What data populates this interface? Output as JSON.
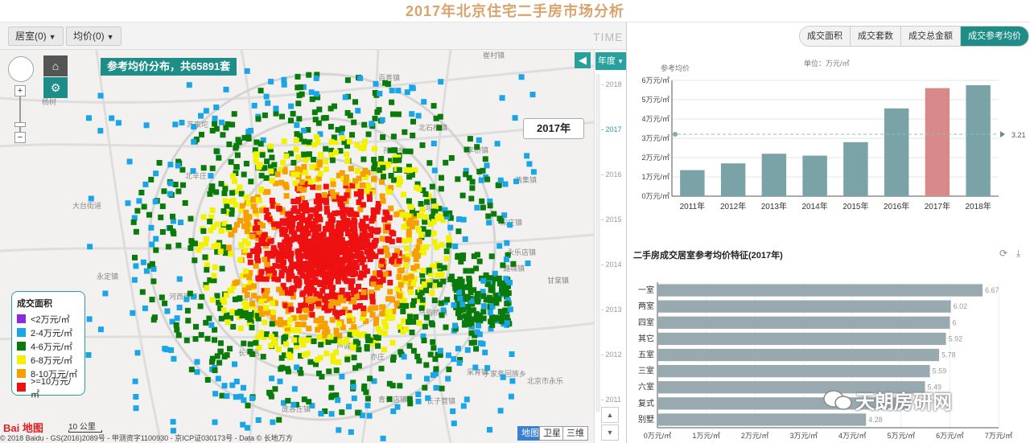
{
  "title": "2017年北京住宅二手房市场分析",
  "toolbar": {
    "room_dd": "居室(0)",
    "price_dd": "均价(0)",
    "time_label": "TIME"
  },
  "map": {
    "count_banner": "参考均价分布，共65891套",
    "year_bubble": "2017年",
    "legend": {
      "title": "成交面积",
      "items": [
        {
          "label": "<2万元/㎡",
          "color": "#8a2be2"
        },
        {
          "label": "2-4万元/㎡",
          "color": "#1aa6e6"
        },
        {
          "label": "4-6万元/㎡",
          "color": "#0a7a0a"
        },
        {
          "label": "6-8万元/㎡",
          "color": "#f2f200"
        },
        {
          "label": "8-10万元/㎡",
          "color": "#f5a000"
        },
        {
          "label": ">=10万元/㎡",
          "color": "#ee1111"
        }
      ]
    },
    "scale": "10 公里",
    "baidu_logo": "Bai 地图",
    "copyright": "© 2018 Baidu - GS(2016)2089号 - 甲测资字1100930 - 京ICP证030173号 - Data © 长地万方",
    "map_types": [
      "地图",
      "卫星",
      "三维"
    ],
    "place_labels": [
      {
        "t": "苏家坨",
        "x": 232,
        "y": 96
      },
      {
        "t": "杨树",
        "x": 52,
        "y": 68
      },
      {
        "t": "大台街道",
        "x": 90,
        "y": 197
      },
      {
        "t": "北辛庄",
        "x": 230,
        "y": 160
      },
      {
        "t": "永定镇",
        "x": 120,
        "y": 285
      },
      {
        "t": "河西街道",
        "x": 210,
        "y": 310
      },
      {
        "t": "长辛店",
        "x": 296,
        "y": 380
      },
      {
        "t": "卢沟桥",
        "x": 300,
        "y": 315
      },
      {
        "t": "东坝乡",
        "x": 520,
        "y": 200
      },
      {
        "t": "黑庄户乡",
        "x": 532,
        "y": 292
      },
      {
        "t": "台湖镇",
        "x": 572,
        "y": 312
      },
      {
        "t": "宋庄镇",
        "x": 622,
        "y": 218
      },
      {
        "t": "永乐店镇",
        "x": 630,
        "y": 255
      },
      {
        "t": "甘棠镇",
        "x": 680,
        "y": 290
      },
      {
        "t": "亦庄",
        "x": 460,
        "y": 385
      },
      {
        "t": "采育镇",
        "x": 580,
        "y": 404
      },
      {
        "t": "庞各庄镇",
        "x": 350,
        "y": 450
      },
      {
        "t": "长子营镇",
        "x": 530,
        "y": 440
      },
      {
        "t": "青云店镇",
        "x": 470,
        "y": 438
      },
      {
        "t": "北京市永乐",
        "x": 655,
        "y": 415
      },
      {
        "t": "于家务回族乡",
        "x": 600,
        "y": 406
      },
      {
        "t": "百善镇",
        "x": 470,
        "y": 38
      },
      {
        "t": "崔村镇",
        "x": 600,
        "y": 10
      },
      {
        "t": "孙河乡",
        "x": 476,
        "y": 128
      },
      {
        "t": "李桥镇",
        "x": 580,
        "y": 128
      },
      {
        "t": "北石槽镇",
        "x": 520,
        "y": 100
      },
      {
        "t": "潞城镇",
        "x": 625,
        "y": 275
      },
      {
        "t": "西集镇",
        "x": 640,
        "y": 165
      },
      {
        "t": "马驹桥镇",
        "x": 520,
        "y": 330
      },
      {
        "t": "芦城乡",
        "x": 418,
        "y": 372
      }
    ]
  },
  "timeline": {
    "year_btn": "年度",
    "years": [
      "2018",
      "2017",
      "2016",
      "2015",
      "2014",
      "2013",
      "2012",
      "2011"
    ],
    "active": "2017"
  },
  "tabs": [
    {
      "label": "成交面积",
      "active": false
    },
    {
      "label": "成交套数",
      "active": false
    },
    {
      "label": "成交总金额",
      "active": false
    },
    {
      "label": "成交参考均价",
      "active": true
    }
  ],
  "chart_data": [
    {
      "type": "bar",
      "title": "",
      "series_label": "参考均价",
      "unit": "单位：万元/㎡",
      "categories": [
        "2011年",
        "2012年",
        "2013年",
        "2014年",
        "2015年",
        "2016年",
        "2017年",
        "2018年"
      ],
      "values": [
        1.35,
        1.7,
        2.2,
        2.1,
        2.8,
        4.55,
        5.6,
        5.75
      ],
      "highlight": "2017年",
      "bar_color": "#7aa3a8",
      "highlight_color": "#d88a8a",
      "ylim": [
        0,
        6
      ],
      "yticks": [
        "0万元/㎡",
        "1万元/㎡",
        "2万元/㎡",
        "3万元/㎡",
        "4万元/㎡",
        "5万元/㎡",
        "6万元/㎡"
      ],
      "average_line": 3.21,
      "average_label": "3.21"
    },
    {
      "type": "bar",
      "orientation": "horizontal",
      "title": "二手房成交居室参考均价特征(2017年)",
      "categories": [
        "一室",
        "两室",
        "四室",
        "其它",
        "五室",
        "三室",
        "六室",
        "复式",
        "别墅"
      ],
      "values": [
        6.67,
        6.02,
        6,
        5.92,
        5.78,
        5.59,
        5.49,
        5.2,
        4.28
      ],
      "value_labels": [
        "6.67",
        "6.02",
        "6",
        "5.92",
        "5.78",
        "5.59",
        "5.49",
        "",
        "4.28"
      ],
      "bar_color": "#98aab0",
      "xlim": [
        0,
        7
      ],
      "xticks": [
        "0万元/㎡",
        "1万元/㎡",
        "2万元/㎡",
        "3万元/㎡",
        "4万元/㎡",
        "5万元/㎡",
        "6万元/㎡",
        "7万元/㎡"
      ]
    }
  ],
  "watermark": "天朗房研网"
}
